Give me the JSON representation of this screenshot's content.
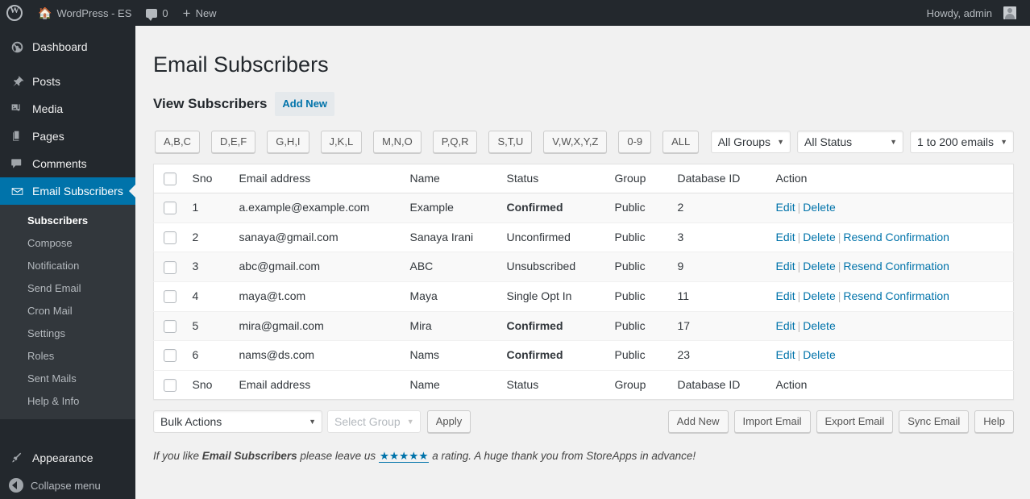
{
  "adminbar": {
    "logo_icon": "wordpress-logo-icon",
    "home_icon": "home-icon",
    "site_name": "WordPress - ES",
    "comments_icon": "comment-bubble-icon",
    "comments_count": "0",
    "new_icon": "plus-icon",
    "new_label": "New",
    "howdy": "Howdy, admin",
    "avatar_icon": "avatar-icon"
  },
  "sidebar": {
    "items": [
      {
        "label": "Dashboard",
        "icon": "dashboard-icon",
        "glyph": "◔"
      },
      {
        "label": "Posts",
        "icon": "pin-icon",
        "glyph": "✐"
      },
      {
        "label": "Media",
        "icon": "media-icon",
        "glyph": "♫"
      },
      {
        "label": "Pages",
        "icon": "pages-icon",
        "glyph": "❑"
      },
      {
        "label": "Comments",
        "icon": "comment-icon",
        "glyph": "⌨"
      },
      {
        "label": "Email Subscribers",
        "icon": "envelope-icon",
        "glyph": "✉"
      }
    ],
    "submenu": [
      {
        "label": "Subscribers",
        "active": true
      },
      {
        "label": "Compose",
        "active": false
      },
      {
        "label": "Notification",
        "active": false
      },
      {
        "label": "Send Email",
        "active": false
      },
      {
        "label": "Cron Mail",
        "active": false
      },
      {
        "label": "Settings",
        "active": false
      },
      {
        "label": "Roles",
        "active": false
      },
      {
        "label": "Sent Mails",
        "active": false
      },
      {
        "label": "Help & Info",
        "active": false
      }
    ],
    "appearance": {
      "label": "Appearance",
      "icon": "paintbrush-icon",
      "glyph": "✒"
    },
    "collapse": {
      "label": "Collapse menu",
      "icon": "collapse-arrow-icon"
    },
    "active_color": "#0073aa"
  },
  "page": {
    "title": "Email Subscribers",
    "subtitle": "View Subscribers",
    "add_new_label": "Add New"
  },
  "filters": {
    "alpha_buttons": [
      "A,B,C",
      "D,E,F",
      "G,H,I",
      "J,K,L",
      "M,N,O",
      "P,Q,R",
      "S,T,U",
      "V,W,X,Y,Z",
      "0-9",
      "ALL"
    ],
    "group_select": "All Groups",
    "status_select": "All Status",
    "count_select": "1 to 200 emails"
  },
  "table": {
    "headers": [
      "Sno",
      "Email address",
      "Name",
      "Status",
      "Group",
      "Database ID",
      "Action"
    ],
    "rows": [
      {
        "sno": "1",
        "email": "a.example@example.com",
        "name": "Example",
        "status": "Confirmed",
        "status_class": "st-confirmed",
        "group": "Public",
        "db_id": "2",
        "actions": [
          "Edit",
          "Delete"
        ]
      },
      {
        "sno": "2",
        "email": "sanaya@gmail.com",
        "name": "Sanaya Irani",
        "status": "Unconfirmed",
        "status_class": "st-unconfirmed",
        "group": "Public",
        "db_id": "3",
        "actions": [
          "Edit",
          "Delete",
          "Resend Confirmation"
        ]
      },
      {
        "sno": "3",
        "email": "abc@gmail.com",
        "name": "ABC",
        "status": "Unsubscribed",
        "status_class": "st-unsubscribed",
        "group": "Public",
        "db_id": "9",
        "actions": [
          "Edit",
          "Delete",
          "Resend Confirmation"
        ]
      },
      {
        "sno": "4",
        "email": "maya@t.com",
        "name": "Maya",
        "status": "Single Opt In",
        "status_class": "st-single",
        "group": "Public",
        "db_id": "11",
        "actions": [
          "Edit",
          "Delete",
          "Resend Confirmation"
        ]
      },
      {
        "sno": "5",
        "email": "mira@gmail.com",
        "name": "Mira",
        "status": "Confirmed",
        "status_class": "st-confirmed",
        "group": "Public",
        "db_id": "17",
        "actions": [
          "Edit",
          "Delete"
        ]
      },
      {
        "sno": "6",
        "email": "nams@ds.com",
        "name": "Nams",
        "status": "Confirmed",
        "status_class": "st-confirmed",
        "group": "Public",
        "db_id": "23",
        "actions": [
          "Edit",
          "Delete"
        ]
      }
    ],
    "status_colors": {
      "confirmed": "#068006",
      "unconfirmed": "#dd3333",
      "unsubscribed": "#c9c34a",
      "single_opt_in": "#3333cc"
    }
  },
  "tablenav": {
    "bulk_actions": "Bulk Actions",
    "select_group": "Select Group",
    "apply_label": "Apply",
    "buttons": [
      "Add New",
      "Import Email",
      "Export Email",
      "Sync Email",
      "Help"
    ]
  },
  "footer": {
    "prefix": "If you like ",
    "plugin_name": "Email Subscribers",
    "middle": " please leave us ",
    "stars": "★★★★★",
    "suffix": " a rating. A huge thank you from StoreApps in advance!"
  }
}
